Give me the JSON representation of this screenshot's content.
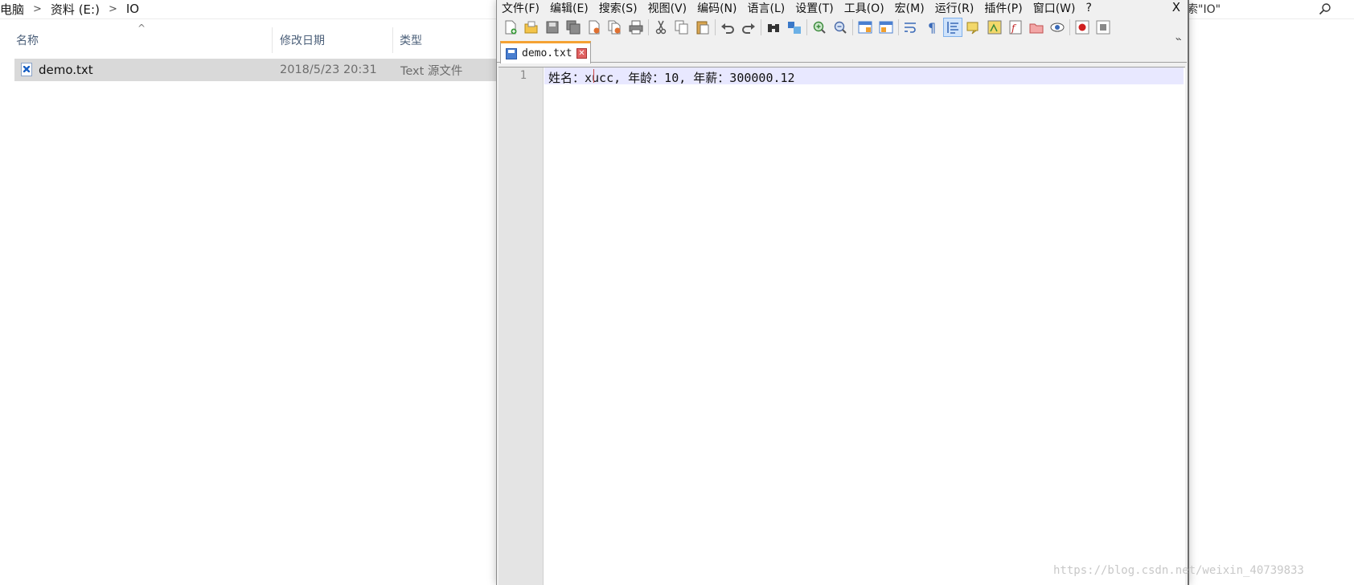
{
  "explorer": {
    "breadcrumb": [
      "电脑",
      "资料 (E:)",
      "IO"
    ],
    "search_text": "索\"IO\"",
    "columns": {
      "name": "名称",
      "date": "修改日期",
      "type": "类型"
    },
    "files": [
      {
        "name": "demo.txt",
        "date": "2018/5/23 20:31",
        "type": "Text 源文件"
      }
    ]
  },
  "npp": {
    "menu": [
      "文件(F)",
      "编辑(E)",
      "搜索(S)",
      "视图(V)",
      "编码(N)",
      "语言(L)",
      "设置(T)",
      "工具(O)",
      "宏(M)",
      "运行(R)",
      "插件(P)",
      "窗口(W)",
      "?"
    ],
    "close_label": "X",
    "overflow_label": "»",
    "tab": {
      "label": "demo.txt",
      "close": "✕"
    },
    "editor": {
      "line_number": "1",
      "text": "姓名：xucc, 年龄：10, 年薪：300000.12"
    }
  },
  "watermark": "https://blog.csdn.net/weixin_40739833"
}
